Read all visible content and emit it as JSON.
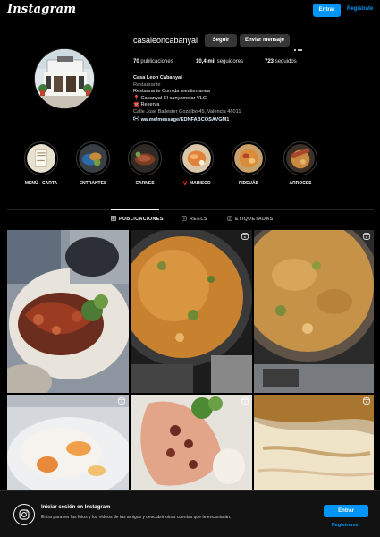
{
  "topbar": {
    "logo": "Instagram",
    "login_label": "Entrar",
    "register_label": "Registrate"
  },
  "profile": {
    "username": "casaleoncabanyal",
    "follow_label": "Seguir",
    "message_label": "Enviar mensaje",
    "stats": {
      "posts_count": "70",
      "posts_label": "publicaciones",
      "followers_count": "10,4 mil",
      "followers_label": "seguidores",
      "following_count": "723",
      "following_label": "seguidos"
    },
    "bio": {
      "name": "Casa Leon Cabanyal",
      "category": "Restaurante",
      "line1": "Restaurante Comida mediterranea",
      "line2": "📍 Cabanyal-El canyamelar VLC",
      "line3": "☎️ Reserva",
      "address": "Calle Jose Ballester Gozalbo 45, Valencia 46011",
      "link": "wa.me/message/EDNFABCOSAVGM1"
    }
  },
  "highlights": [
    {
      "label": "MENÚ - CARTA"
    },
    {
      "label": "ENTRANTES"
    },
    {
      "label": "CARNES"
    },
    {
      "label": "🦞 MARISCO"
    },
    {
      "label": "FIDEUÁS"
    },
    {
      "label": "ARROCES"
    }
  ],
  "tabs": [
    {
      "label": "PUBLICACIONES"
    },
    {
      "label": "REELS"
    },
    {
      "label": "ETIQUETADAS"
    }
  ],
  "banner": {
    "title": "Iniciar sesión en Instagram",
    "description": "Entra para ver las fotos y los vídeos de tus amigos y descubrir otras cuentas que te encantarán.",
    "login_label": "Entrar",
    "register_label": "Registrarse"
  },
  "colors": {
    "accent": "#0095f6",
    "background": "#000000",
    "button_gray": "#363636"
  }
}
